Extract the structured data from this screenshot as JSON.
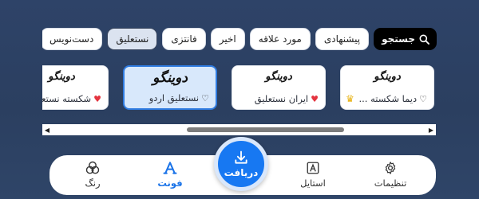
{
  "chips": {
    "search_label": "جستجو",
    "items": [
      "پیشنهادی",
      "مورد علاقه",
      "اخیر",
      "فانتزی",
      "نستعلیق",
      "دست‌نویس"
    ],
    "active_index": 4
  },
  "cards": [
    {
      "preview": "دوینگو",
      "caption": "دیما شکسته ...",
      "favorite": false,
      "premium": true
    },
    {
      "preview": "دوینگو",
      "caption": "ایران نستعلیق",
      "favorite": true,
      "premium": false
    },
    {
      "preview": "دوینگو",
      "caption": "نستعلیق اردو",
      "favorite": false,
      "premium": false,
      "selected": true
    },
    {
      "preview": "دوینگو",
      "caption": "شکسته نستعلیق",
      "favorite": true,
      "premium": false
    }
  ],
  "scroll": {
    "position": 0.62,
    "visible_fraction": 0.42
  },
  "nav": {
    "settings_label": "تنظیمات",
    "style_label": "استایل",
    "download_label": "دریافت",
    "font_label": "فونت",
    "color_label": "رنگ"
  },
  "colors": {
    "accent": "#1778f2",
    "background": "#2e4368",
    "favorite": "#e4343f",
    "premium": "#e8b315"
  }
}
